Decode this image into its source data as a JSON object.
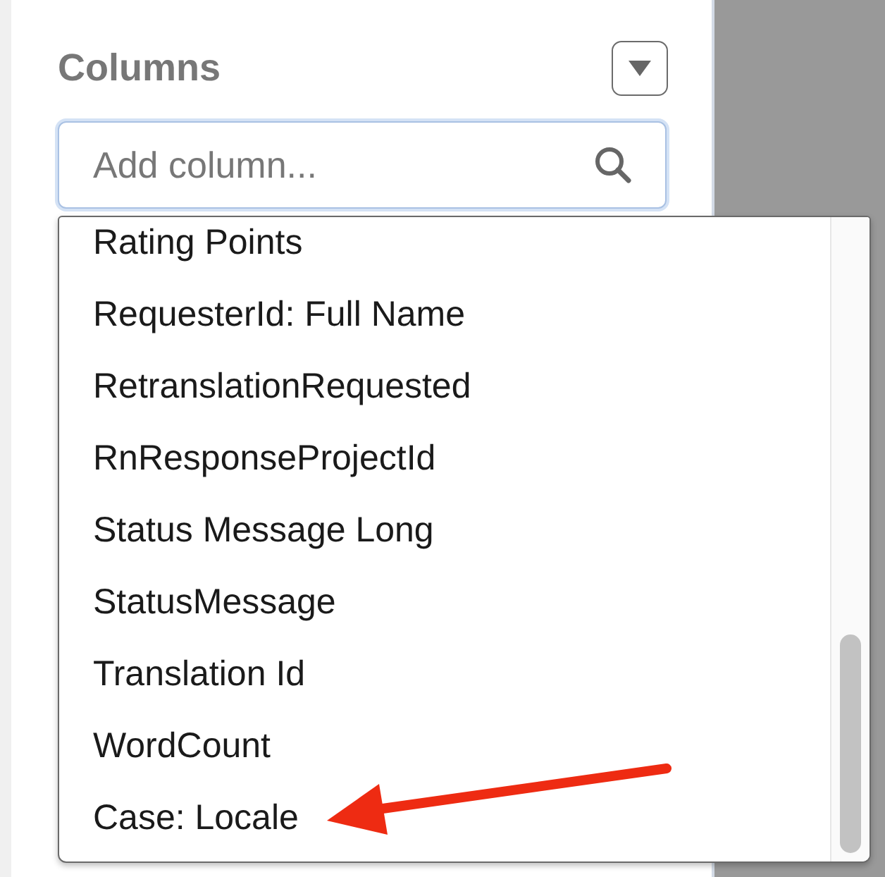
{
  "panel": {
    "title": "Columns"
  },
  "search": {
    "placeholder": "Add column...",
    "focused": true
  },
  "dropdown": {
    "options": [
      {
        "label": "Rating Points",
        "selected": false
      },
      {
        "label": "RequesterId: Full Name",
        "selected": false
      },
      {
        "label": "RetranslationRequested",
        "selected": false
      },
      {
        "label": "RnResponseProjectId",
        "selected": false
      },
      {
        "label": "Status Message Long",
        "selected": false
      },
      {
        "label": "StatusMessage",
        "selected": false
      },
      {
        "label": "Translation Id",
        "selected": false
      },
      {
        "label": "WordCount",
        "selected": false
      },
      {
        "label": "Case: Locale",
        "selected": false
      }
    ]
  }
}
